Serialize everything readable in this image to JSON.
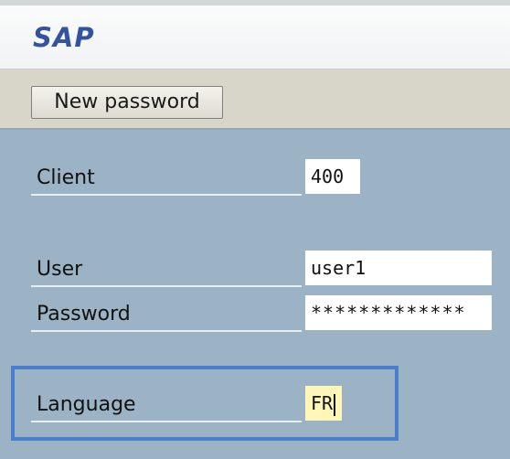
{
  "header": {
    "logo": "SAP"
  },
  "toolbar": {
    "new_password_label": "New password"
  },
  "form": {
    "client": {
      "label": "Client",
      "value": "400"
    },
    "user": {
      "label": "User",
      "value": "user1"
    },
    "password": {
      "label": "Password",
      "value": "*************"
    },
    "language": {
      "label": "Language",
      "value": "FR"
    }
  }
}
